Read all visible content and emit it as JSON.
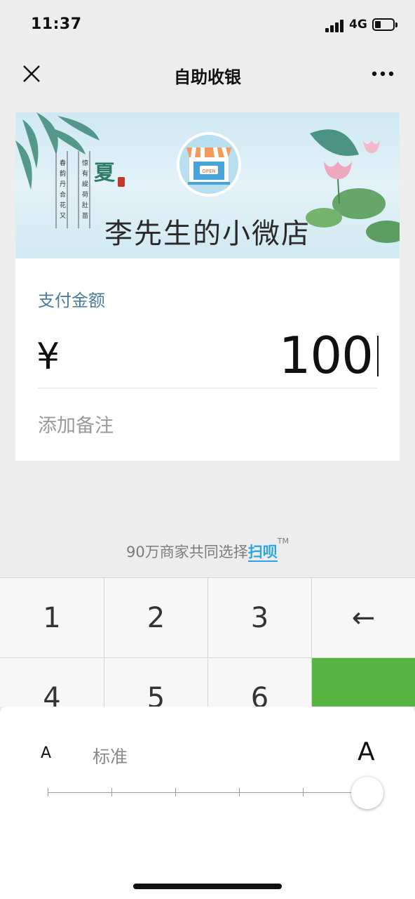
{
  "status_bar": {
    "time": "11:37",
    "network": "4G"
  },
  "nav": {
    "title": "自助收银",
    "close_icon": "close-icon",
    "more_icon": "more-icon"
  },
  "banner": {
    "shop_name": "李先生的小微店",
    "store_icon": "store-open-icon",
    "sign_text": "OPEN",
    "seal_text": "夏"
  },
  "payment": {
    "amount_label": "支付金额",
    "currency_symbol": "¥",
    "amount": "100",
    "note_placeholder": "添加备注"
  },
  "promo": {
    "text": "90万商家共同选择",
    "brand": "扫呗",
    "trademark": "TM"
  },
  "keypad": {
    "keys": [
      "1",
      "2",
      "3",
      "←",
      "4",
      "5",
      "6",
      ""
    ],
    "confirm_color": "#56b540"
  },
  "font_panel": {
    "small_label": "A",
    "standard_label": "标准",
    "large_label": "A",
    "level": 5,
    "levels": 6
  },
  "colors": {
    "accent_green": "#56b540",
    "label_blue": "#4a7d9a",
    "brand_blue": "#2aa3e8"
  }
}
